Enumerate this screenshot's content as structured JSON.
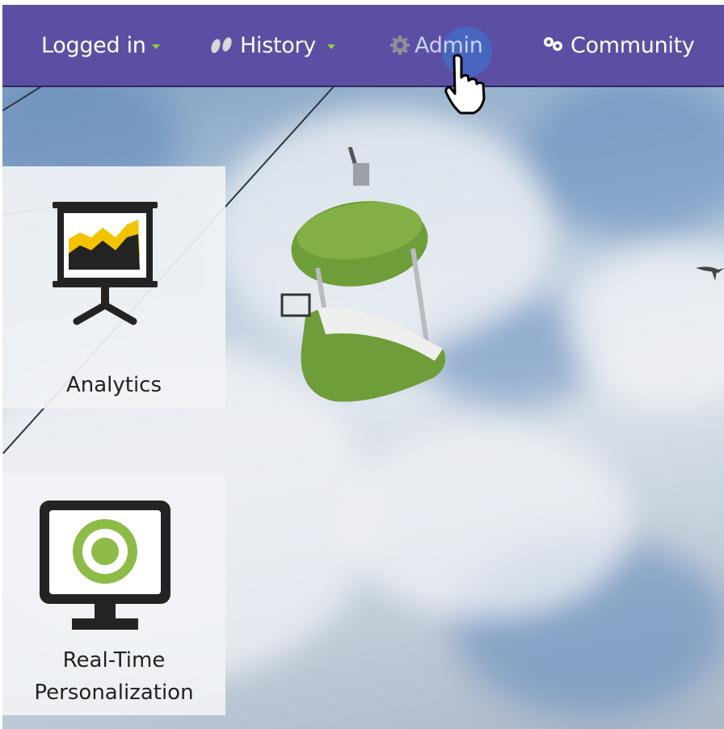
{
  "navbar": {
    "items": [
      {
        "label": "Logged in",
        "icon": "none",
        "has_caret": true
      },
      {
        "label": "History",
        "icon": "footprints-icon",
        "has_caret": true
      },
      {
        "label": "Admin",
        "icon": "gear-icon",
        "has_caret": false
      },
      {
        "label": "Community",
        "icon": "map-pins-icon",
        "has_caret": false
      }
    ],
    "background_color": "#5b4fa3",
    "caret_color": "#8fd142"
  },
  "tiles": {
    "analytics": {
      "label": "Analytics",
      "icon": "presentation-chart-icon"
    },
    "personalization": {
      "label_line1": "Real-Time",
      "label_line2": "Personalization",
      "icon": "monitor-target-icon"
    }
  },
  "background": {
    "subject": "green gondola chairlift against cloudy sky"
  }
}
